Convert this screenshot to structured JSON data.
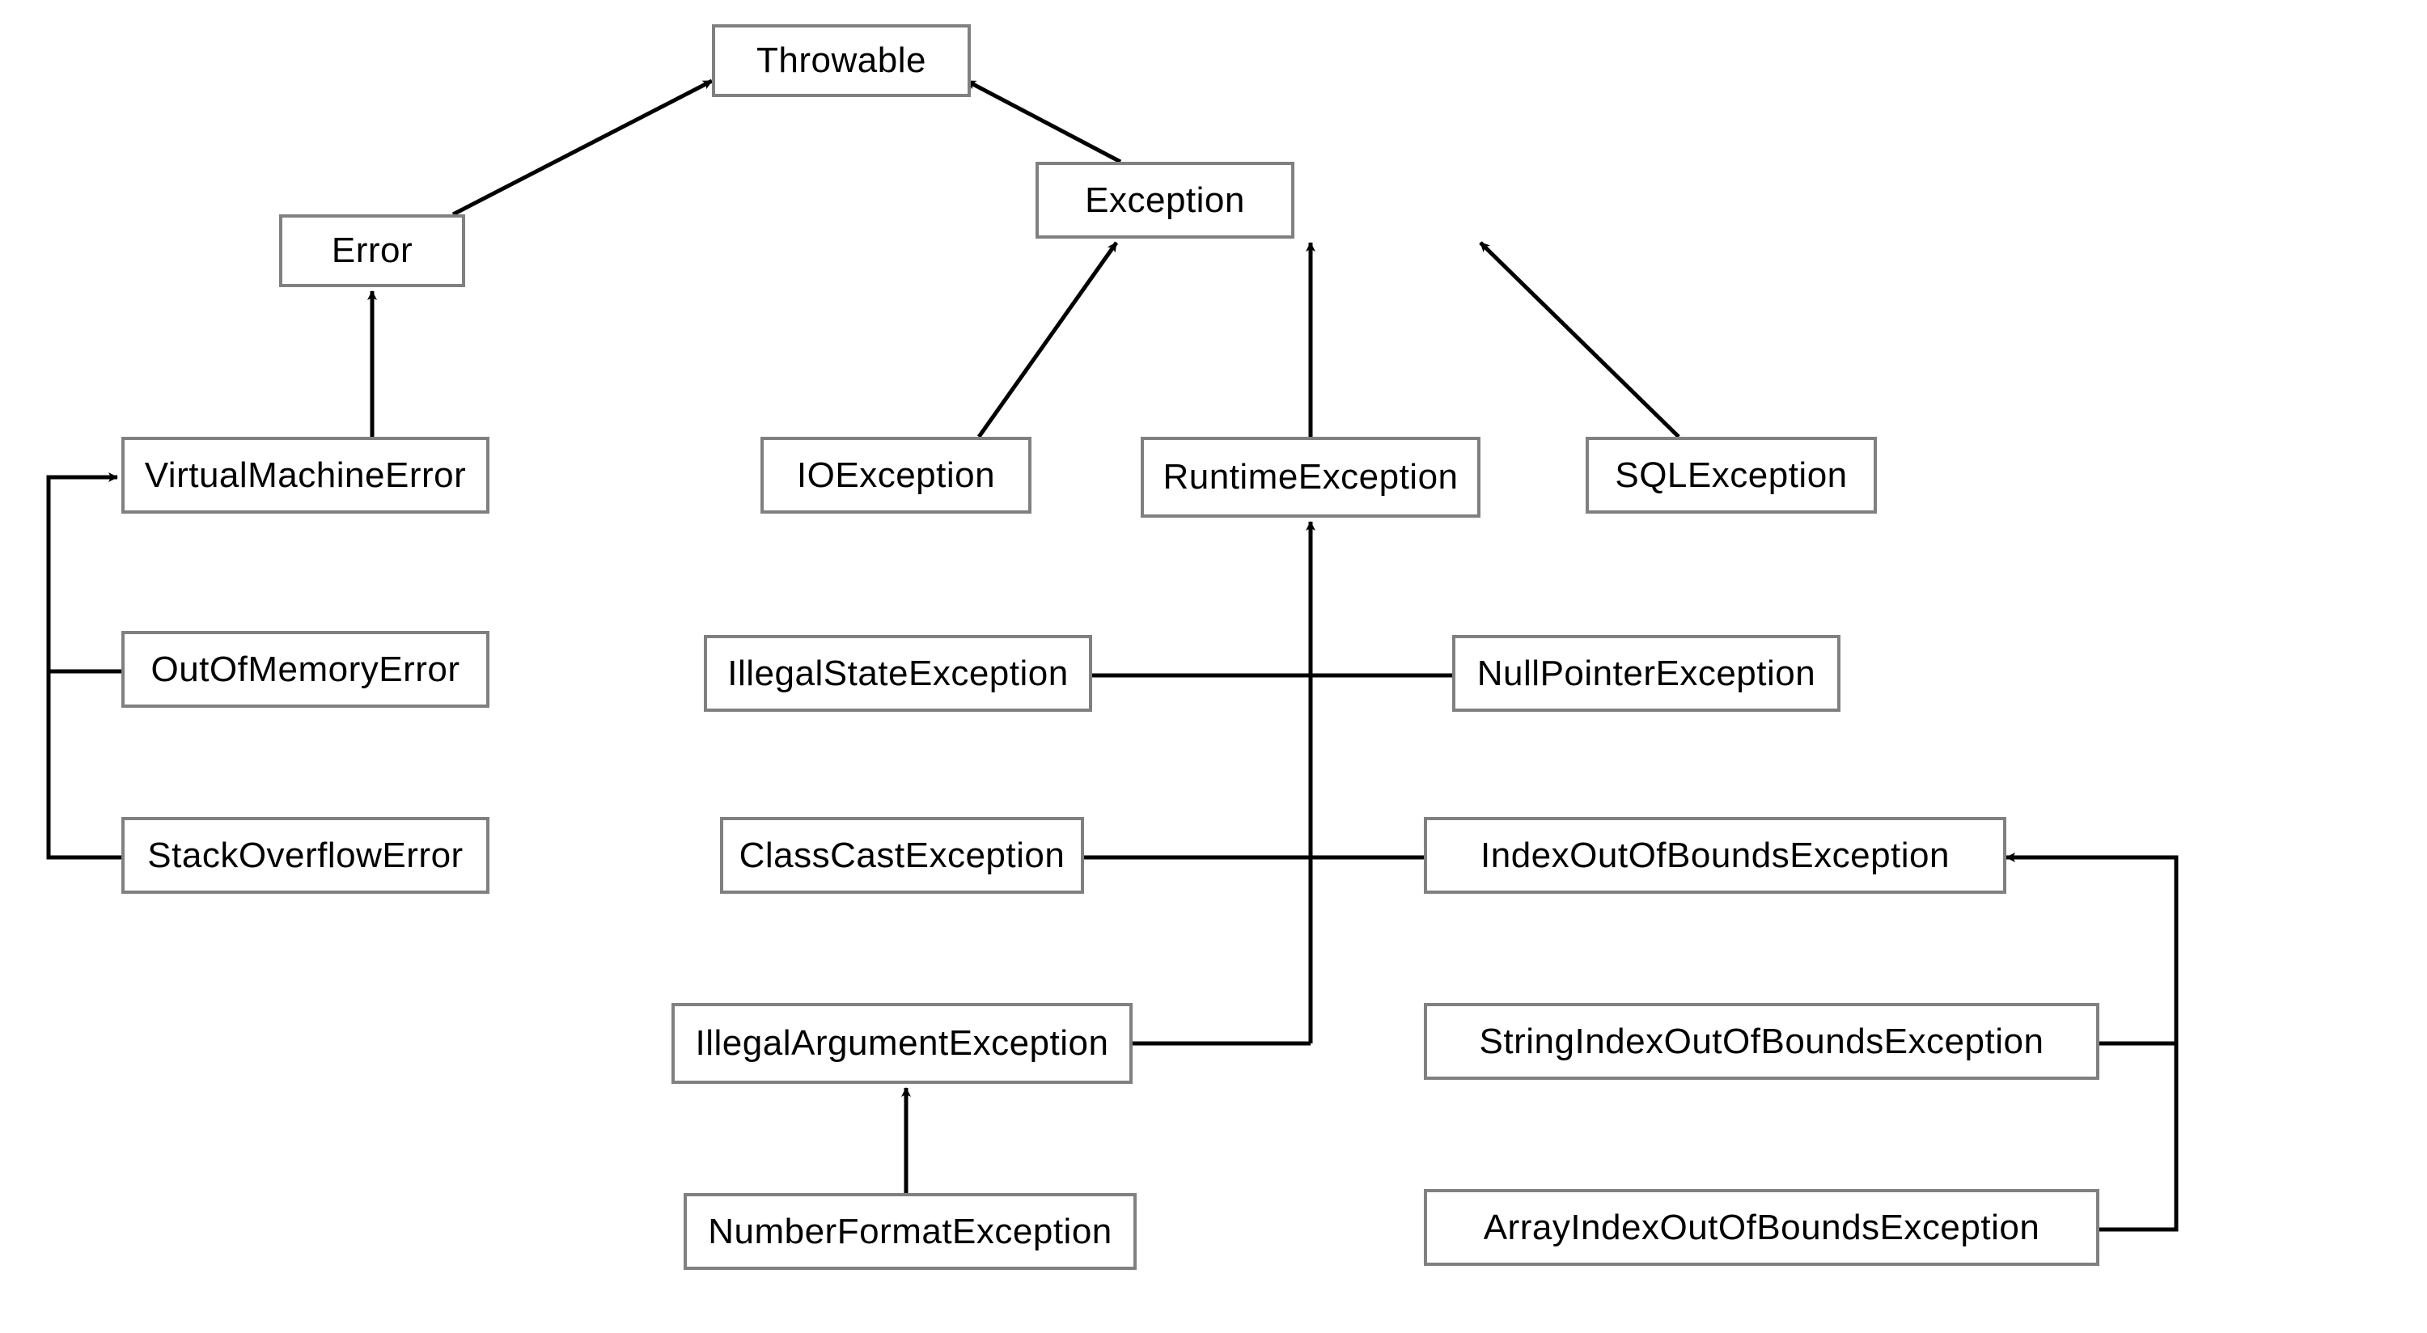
{
  "diagram": {
    "type": "class-hierarchy",
    "nodes": {
      "throwable": {
        "label": "Throwable"
      },
      "error": {
        "label": "Error"
      },
      "exception": {
        "label": "Exception"
      },
      "virtualmachineerror": {
        "label": "VirtualMachineError"
      },
      "outofmemoryerror": {
        "label": "OutOfMemoryError"
      },
      "stackoverflowerror": {
        "label": "StackOverflowError"
      },
      "ioexception": {
        "label": "IOException"
      },
      "runtimeexception": {
        "label": "RuntimeException"
      },
      "sqlexception": {
        "label": "SQLException"
      },
      "illegalstateexception": {
        "label": "IllegalStateException"
      },
      "nullpointerexception": {
        "label": "NullPointerException"
      },
      "classcastexception": {
        "label": "ClassCastException"
      },
      "indexoutofboundsexception": {
        "label": "IndexOutOfBoundsException"
      },
      "illegalargumentexception": {
        "label": "IllegalArgumentException"
      },
      "stringindexoutofboundsexception": {
        "label": "StringIndexOutOfBoundsException"
      },
      "numberformatexception": {
        "label": "NumberFormatException"
      },
      "arrayindexoutofboundsexception": {
        "label": "ArrayIndexOutOfBoundsException"
      }
    },
    "edges": [
      {
        "from": "error",
        "to": "throwable"
      },
      {
        "from": "exception",
        "to": "throwable"
      },
      {
        "from": "virtualmachineerror",
        "to": "error"
      },
      {
        "from": "outofmemoryerror",
        "to": "virtualmachineerror"
      },
      {
        "from": "stackoverflowerror",
        "to": "virtualmachineerror"
      },
      {
        "from": "ioexception",
        "to": "exception"
      },
      {
        "from": "runtimeexception",
        "to": "exception"
      },
      {
        "from": "sqlexception",
        "to": "exception"
      },
      {
        "from": "illegalstateexception",
        "to": "runtimeexception"
      },
      {
        "from": "nullpointerexception",
        "to": "runtimeexception"
      },
      {
        "from": "classcastexception",
        "to": "runtimeexception"
      },
      {
        "from": "indexoutofboundsexception",
        "to": "runtimeexception"
      },
      {
        "from": "illegalargumentexception",
        "to": "runtimeexception"
      },
      {
        "from": "numberformatexception",
        "to": "illegalargumentexception"
      },
      {
        "from": "stringindexoutofboundsexception",
        "to": "indexoutofboundsexception"
      },
      {
        "from": "arrayindexoutofboundsexception",
        "to": "indexoutofboundsexception"
      }
    ]
  }
}
